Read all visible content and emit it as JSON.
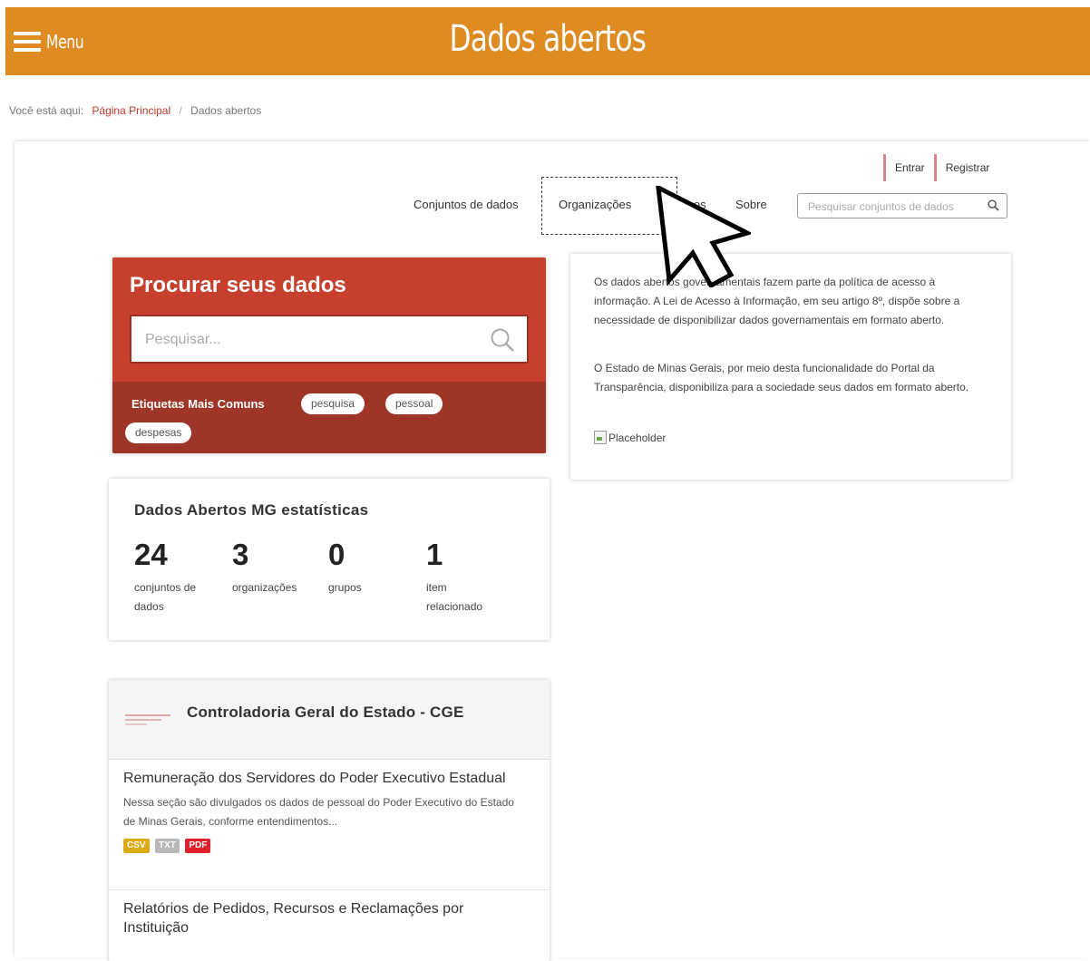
{
  "header": {
    "menu_label": "Menu",
    "site_title": "Dados abertos",
    "bg_color": "#de8b22"
  },
  "breadcrumb": {
    "prefix": "Você está aqui:",
    "home": "Página Principal",
    "current": "Dados abertos"
  },
  "account": {
    "login": "Entrar",
    "register": "Registrar"
  },
  "nav": {
    "items": [
      "Conjuntos de dados",
      "Organizações",
      "Grupos",
      "Sobre"
    ],
    "search_placeholder": "Pesquisar conjuntos de dados"
  },
  "hero": {
    "title": "Procurar seus dados",
    "search_placeholder": "Pesquisar...",
    "tags_label": "Etiquetas Mais Comuns",
    "tags": [
      "pesquisa",
      "pessoal",
      "despesas"
    ],
    "top_color": "#c7402e",
    "bottom_color": "#9f3526"
  },
  "stats": {
    "title": "Dados Abertos MG estatísticas",
    "items": [
      {
        "value": "24",
        "label": "conjuntos de dados"
      },
      {
        "value": "3",
        "label": "organizações"
      },
      {
        "value": "0",
        "label": "grupos"
      },
      {
        "value": "1",
        "label": "item relacionado"
      }
    ]
  },
  "info": {
    "paragraph1": "Os dados abertos governamentais fazem parte da política de acesso à informação. A Lei de Acesso à Informação, em seu artigo 8º, dispõe sobre a necessidade de disponibilizar dados governamentais em formato aberto.",
    "paragraph2": "O Estado de Minas Gerais, por meio desta funcionalidade do Portal da Transparência, disponibiliza para a sociedade seus dados em formato aberto.",
    "image_alt": "Placeholder"
  },
  "organization": {
    "name": "Controladoria Geral do Estado - CGE",
    "datasets": [
      {
        "title": "Remuneração dos Servidores do Poder Executivo Estadual",
        "description": "Nessa seção são divulgados os dados de pessoal do Poder Executivo do Estado de Minas Gerais, conforme entendimentos...",
        "formats": [
          {
            "label": "CSV",
            "color": "#dfa913"
          },
          {
            "label": "TXT",
            "color": "#b9b9b9"
          },
          {
            "label": "PDF",
            "color": "#e0212b"
          }
        ]
      },
      {
        "title": "Relatórios de Pedidos, Recursos e Reclamações por Instituição"
      }
    ]
  }
}
